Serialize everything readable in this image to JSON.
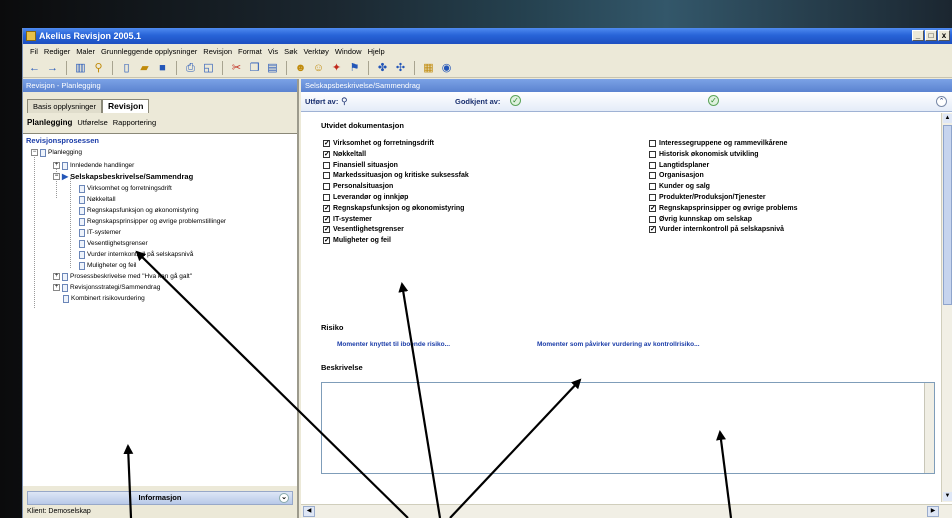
{
  "window": {
    "title": "Akelius Revisjon 2005.1",
    "controls": [
      "_",
      "□",
      "x"
    ]
  },
  "menubar": [
    "Fil",
    "Rediger",
    "Maler",
    "Grunnleggende opplysninger",
    "Revisjon",
    "Format",
    "Vis",
    "Søk",
    "Verktøy",
    "Window",
    "Hjelp"
  ],
  "left": {
    "header": "Revisjon - Planlegging",
    "tabs": [
      "Basis opplysninger",
      "Revisjon"
    ],
    "subtabs": [
      "Planlegging",
      "Utførelse",
      "Rapportering"
    ],
    "tree": {
      "root": "Revisjonsprosessen",
      "nodes": [
        "Planlegging",
        "Innledende handlinger",
        "Selskapsbeskrivelse/Sammendrag",
        "Virksomhet og forretningsdrift",
        "Nøkkeltall",
        "Regnskapsfunksjon og økonomistyring",
        "Regnskapsprinsipper og øvrige problemstillinger",
        "IT-systemer",
        "Vesentlighetsgrenser",
        "Vurder internkontroll på selskapsnivå",
        "Muligheter og feil",
        "Prosessbeskrivelse med \"Hva kan gå galt\"",
        "Revisjonsstrategi/Sammendrag",
        "Kombinert risikovurdering"
      ]
    },
    "info_header": "Informasjon",
    "klient": "Klient: Demoselskap"
  },
  "right": {
    "header": "Selskapsbeskrivelse/Sammendrag",
    "utfort_label": "Utført av:",
    "godkjent_label": "Godkjent av:",
    "doc_title": "Utvidet dokumentasjon",
    "checkboxes_left": [
      {
        "label": "Virksomhet og forretningsdrift",
        "checked": true
      },
      {
        "label": "Nøkkeltall",
        "checked": true
      },
      {
        "label": "Finansiell situasjon",
        "checked": false
      },
      {
        "label": "Markedssituasjon og kritiske suksessfak",
        "checked": false
      },
      {
        "label": "Personalsituasjon",
        "checked": false
      },
      {
        "label": "Leverandør og innkjøp",
        "checked": false
      },
      {
        "label": "Regnskapsfunksjon og økonomistyring",
        "checked": true
      },
      {
        "label": "IT-systemer",
        "checked": true
      },
      {
        "label": "Vesentlighetsgrenser",
        "checked": true
      },
      {
        "label": "Muligheter og feil",
        "checked": true
      }
    ],
    "checkboxes_right": [
      {
        "label": "Interessegruppene og rammevilkårene",
        "checked": false
      },
      {
        "label": "Historisk økonomisk utvikling",
        "checked": false
      },
      {
        "label": "Langtidsplaner",
        "checked": false
      },
      {
        "label": "Organisasjon",
        "checked": false
      },
      {
        "label": "Kunder og salg",
        "checked": false
      },
      {
        "label": "Produkter/Produksjon/Tjenester",
        "checked": false
      },
      {
        "label": "Regnskapsprinsipper og øvrige problems",
        "checked": true
      },
      {
        "label": "Øvrig kunnskap om selskap",
        "checked": false
      },
      {
        "label": "Vurder internkontroll på selskapsnivå",
        "checked": true
      }
    ],
    "risiko_title": "Risiko",
    "risiko_links": [
      "Momenter knyttet til iboende risiko...",
      "Momenter som påvirker vurdering av kontrollrisiko..."
    ],
    "beskrivelse_title": "Beskrivelse",
    "check_mark": "✓"
  },
  "colors": {
    "title_blue": "#2864d8",
    "pane_header": "#5b83d0",
    "link": "#1a3ca8",
    "annotation": "#000000"
  }
}
